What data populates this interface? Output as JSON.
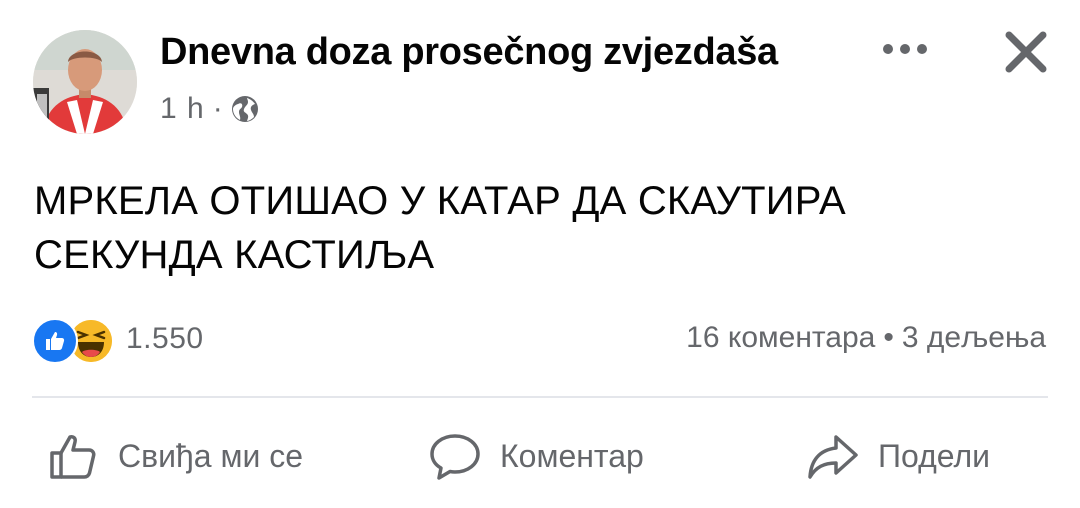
{
  "header": {
    "page_name": "Dnevna doza prosečnog zvjezdaša",
    "time": "1 h",
    "time_separator": "·",
    "privacy_icon": "globe-icon",
    "more_icon": "more-dots-icon",
    "close_icon": "close-icon"
  },
  "post": {
    "text_lines": [
      "МРКЕЛА ОТИШАО У КАТАР ДА СКАУТИРА",
      "СЕКУНДА КАСТИЉА"
    ]
  },
  "reactions": {
    "icons": [
      "like-reaction-icon",
      "haha-reaction-icon"
    ],
    "count": "1.550"
  },
  "stats": {
    "comments": "16 коментара",
    "separator": "•",
    "shares": "3 дељења"
  },
  "actions": {
    "like_label": "Свиђа ми се",
    "comment_label": "Коментар",
    "share_label": "Подели"
  },
  "colors": {
    "text_primary": "#050505",
    "text_secondary": "#65676b",
    "like_blue": "#1877f2",
    "haha_yellow": "#f7b928",
    "divider": "#e4e6eb"
  }
}
